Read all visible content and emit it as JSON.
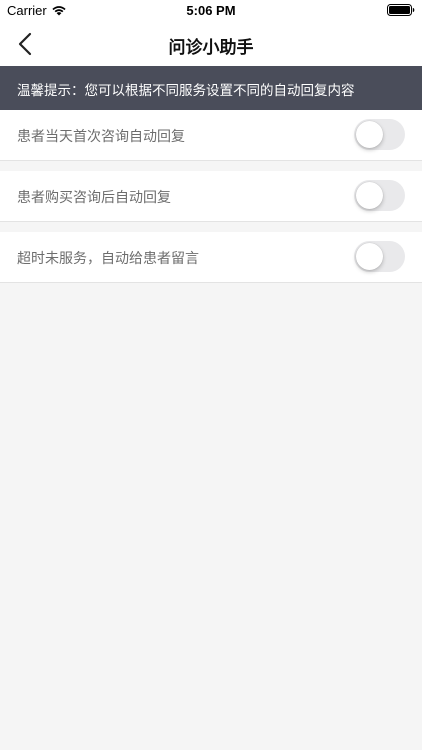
{
  "status_bar": {
    "carrier": "Carrier",
    "time": "5:06 PM"
  },
  "nav": {
    "back_icon": "chevron-left-icon",
    "title": "问诊小助手"
  },
  "tip": {
    "text": "温馨提示：您可以根据不同服务设置不同的自动回复内容"
  },
  "settings": [
    {
      "label": "患者当天首次咨询自动回复",
      "enabled": false
    },
    {
      "label": "患者购买咨询后自动回复",
      "enabled": false
    },
    {
      "label": "超时未服务，自动给患者留言",
      "enabled": false
    }
  ],
  "colors": {
    "tip_background": "#4a4d5a",
    "page_background": "#f5f5f5",
    "toggle_off": "#e9e9eb"
  }
}
